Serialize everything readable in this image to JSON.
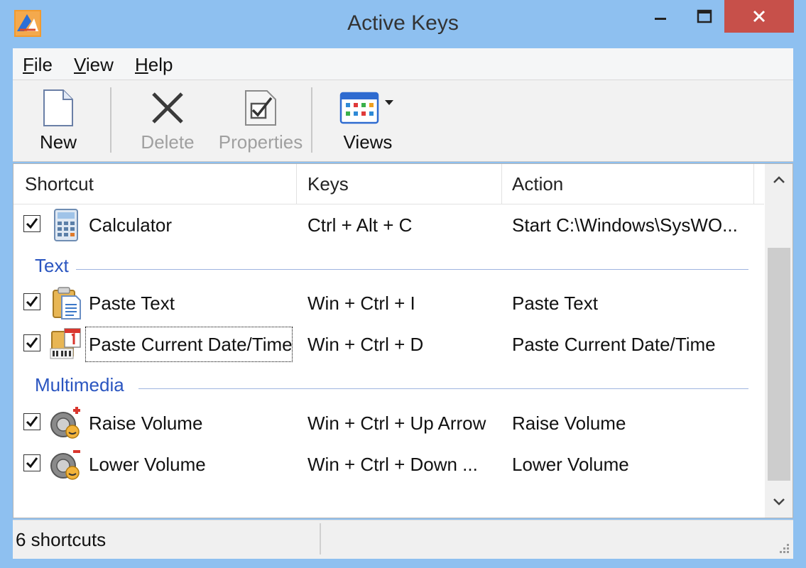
{
  "window": {
    "title": "Active Keys"
  },
  "menu": [
    {
      "accel": "F",
      "rest": "ile"
    },
    {
      "accel": "V",
      "rest": "iew"
    },
    {
      "accel": "H",
      "rest": "elp"
    }
  ],
  "toolbar": {
    "new_label": "New",
    "delete_label": "Delete",
    "properties_label": "Properties",
    "views_label": "Views"
  },
  "list": {
    "columns": [
      "Shortcut",
      "Keys",
      "Action"
    ],
    "rows": [
      {
        "shortcut": "Calculator",
        "keys": "Ctrl + Alt + C",
        "action": "Start C:\\Windows\\SysWO...",
        "icon": "calculator-icon",
        "checked": true
      },
      {
        "shortcut": "Paste Text",
        "keys": "Win + Ctrl + I",
        "action": "Paste Text",
        "icon": "paste-text-icon",
        "checked": true
      },
      {
        "shortcut": "Paste Current Date/Time",
        "keys": "Win + Ctrl + D",
        "action": "Paste Current Date/Time",
        "icon": "calendar-clock-icon",
        "checked": true
      },
      {
        "shortcut": "Raise Volume",
        "keys": "Win + Ctrl + Up Arrow",
        "action": "Raise Volume",
        "icon": "raise-volume-icon",
        "checked": true
      },
      {
        "shortcut": "Lower Volume",
        "keys": "Win + Ctrl + Down ...",
        "action": "Lower Volume",
        "icon": "lower-volume-icon",
        "checked": true
      }
    ],
    "groups": [
      "Text",
      "Multimedia"
    ]
  },
  "status": {
    "text": "6 shortcuts"
  },
  "colors": {
    "title_bar": "#8ec0f0",
    "close_button": "#c7504a",
    "group_label": "#2a55c0"
  }
}
